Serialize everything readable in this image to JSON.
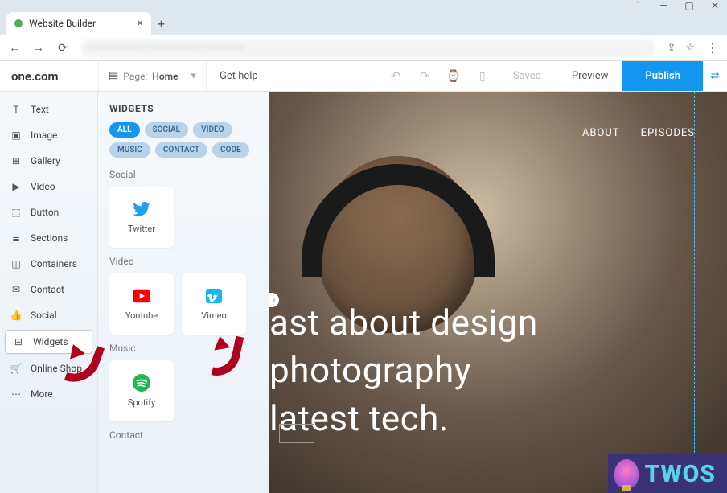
{
  "browser": {
    "tab_title": "Website Builder",
    "controls": {
      "min": "—",
      "max": "▢",
      "close": "✕",
      "new_tab": "+",
      "back": "←",
      "forward": "→",
      "reload": "⟳",
      "share": "⇪",
      "star": "☆",
      "menu": "⋮"
    }
  },
  "app": {
    "brand": "one.com",
    "page_picker": {
      "label": "Page:",
      "value": "Home"
    },
    "get_help": "Get help",
    "status": "Saved",
    "preview": "Preview",
    "publish": "Publish"
  },
  "sidebar": {
    "items": [
      {
        "icon": "T",
        "label": "Text"
      },
      {
        "icon": "▣",
        "label": "Image"
      },
      {
        "icon": "⊞",
        "label": "Gallery"
      },
      {
        "icon": "▶",
        "label": "Video"
      },
      {
        "icon": "⬚",
        "label": "Button"
      },
      {
        "icon": "≣",
        "label": "Sections"
      },
      {
        "icon": "◫",
        "label": "Containers"
      },
      {
        "icon": "✉",
        "label": "Contact"
      },
      {
        "icon": "👍",
        "label": "Social"
      },
      {
        "icon": "⊟",
        "label": "Widgets"
      },
      {
        "icon": "🛒",
        "label": "Online Shop"
      },
      {
        "icon": "⋯",
        "label": "More"
      }
    ],
    "active_index": 9
  },
  "widget_panel": {
    "title": "WIDGETS",
    "filters": [
      "ALL",
      "SOCIAL",
      "VIDEO",
      "MUSIC",
      "CONTACT",
      "CODE"
    ],
    "active_filter": 0,
    "sections": [
      {
        "title": "Social",
        "tiles": [
          {
            "label": "Twitter",
            "icon": "twitter",
            "color": "#1da1f2"
          }
        ]
      },
      {
        "title": "Video",
        "tiles": [
          {
            "label": "Youtube",
            "icon": "youtube",
            "color": "#ff0000"
          },
          {
            "label": "Vimeo",
            "icon": "vimeo",
            "color": "#1ab7ea"
          }
        ]
      },
      {
        "title": "Music",
        "tiles": [
          {
            "label": "Spotify",
            "icon": "spotify",
            "color": "#1db954"
          }
        ]
      },
      {
        "title": "Contact",
        "tiles": []
      }
    ]
  },
  "canvas": {
    "nav": [
      "ABOUT",
      "EPISODES"
    ],
    "hero_lines": [
      "ast about design",
      "photography",
      "latest tech."
    ]
  },
  "watermark": "TWOS"
}
